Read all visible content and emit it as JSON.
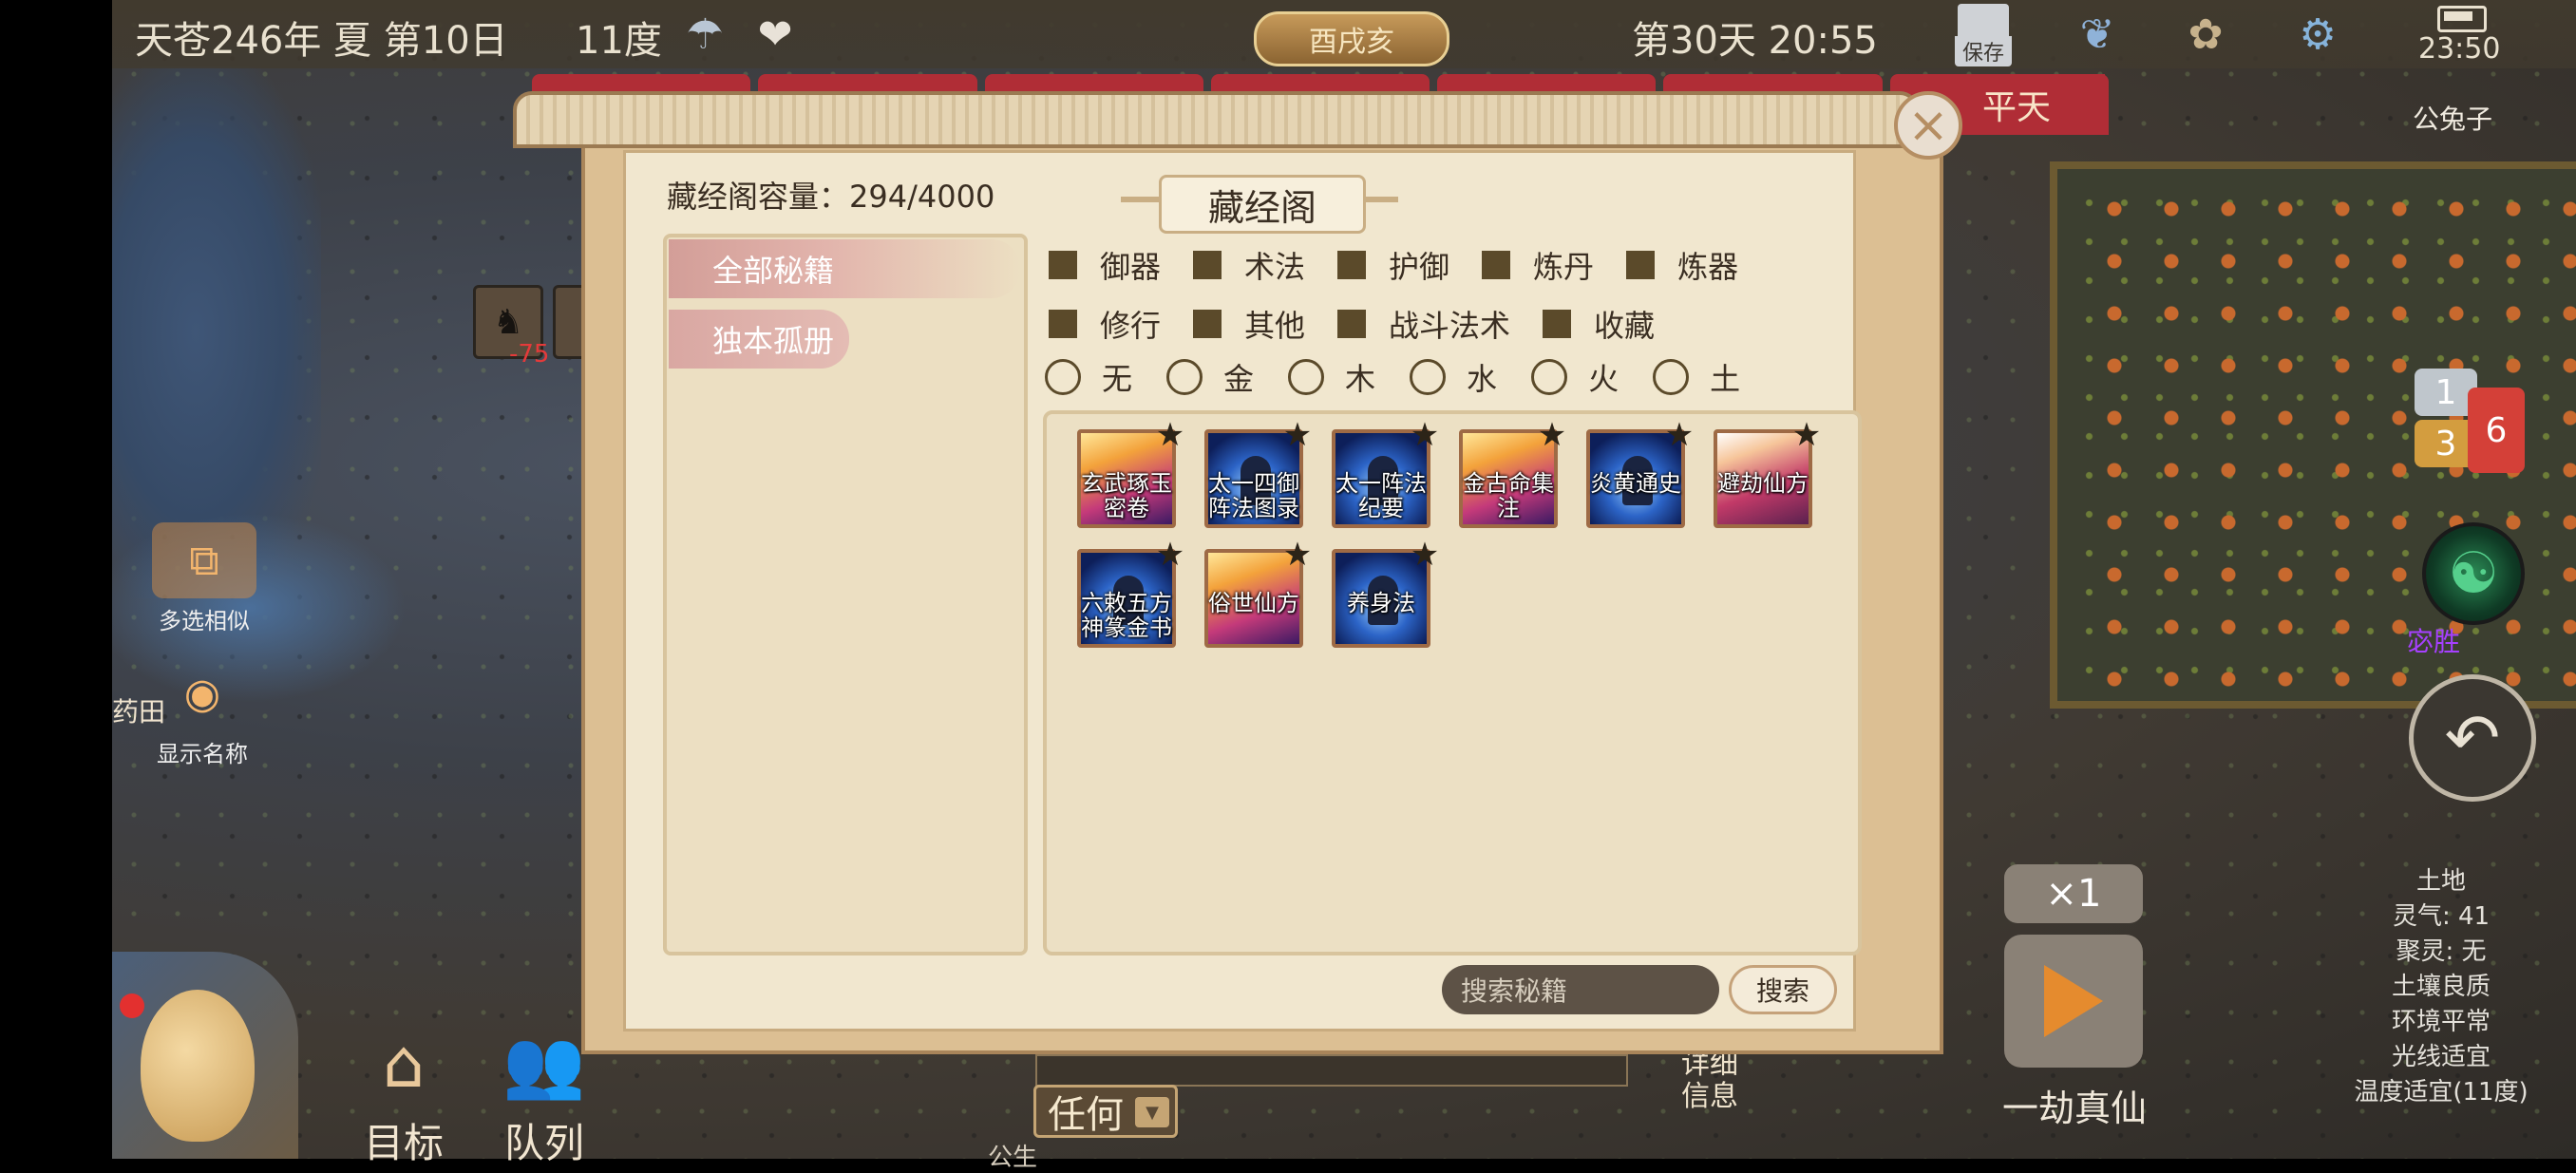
{
  "hud": {
    "date": "天苍246年 夏 第10日",
    "temperature": "11度",
    "weather_icon": "rain-cloud-icon",
    "wind_icon": "wind-heart-icon",
    "time_badge": "酉戌亥",
    "day_time": "第30天 20:55",
    "save_label": "保存",
    "phone_clock": "23:50",
    "npc_name": "公兔子"
  },
  "background_tabs": {
    "pingtian": "平天"
  },
  "left_tools": {
    "multi_select": "多选相似",
    "show_names": "显示名称",
    "yaotian": "药田",
    "pawn_value": "-75"
  },
  "bottom_bar": {
    "target": "目标",
    "queue": "队列",
    "renhe": "任何",
    "detail": "详细信息",
    "footer_char": "公生"
  },
  "right_panel": {
    "bubble1": "1",
    "bubble2": "3",
    "flag_count": "6",
    "shengyang": "宓胜",
    "speed": "×1",
    "yijie": "一劫真仙",
    "terrain": [
      "土地",
      "灵气: 41",
      "聚灵: 无",
      "土壤良质",
      "环境平常",
      "光线适宜",
      "温度适宜(11度)"
    ]
  },
  "modal": {
    "title": "藏经阁",
    "capacity_label": "藏经阁容量：294/4000",
    "side_tabs": [
      {
        "label": "全部秘籍",
        "active": true
      },
      {
        "label": "独本孤册",
        "active": false
      }
    ],
    "category_filters_row1": [
      "御器",
      "术法",
      "护御",
      "炼丹",
      "炼器"
    ],
    "category_filters_row2": [
      "修行",
      "其他",
      "战斗法术",
      "收藏"
    ],
    "element_filters": [
      "无",
      "金",
      "木",
      "水",
      "火",
      "土"
    ],
    "books": [
      {
        "name": "玄武琢玉密卷",
        "style": "red"
      },
      {
        "name": "太一四御阵法图录",
        "style": "blue"
      },
      {
        "name": "太一阵法纪要",
        "style": "blue"
      },
      {
        "name": "金古命集注",
        "style": "red"
      },
      {
        "name": "炎黄通史",
        "style": "blue"
      },
      {
        "name": "避劫仙方",
        "style": "red2"
      },
      {
        "name": "六敕五方神篆金书",
        "style": "blue"
      },
      {
        "name": "俗世仙方",
        "style": "red"
      },
      {
        "name": "养身法",
        "style": "blue"
      }
    ],
    "search_placeholder": "搜索秘籍",
    "search_button": "搜索",
    "close_icon": "close-icon"
  }
}
